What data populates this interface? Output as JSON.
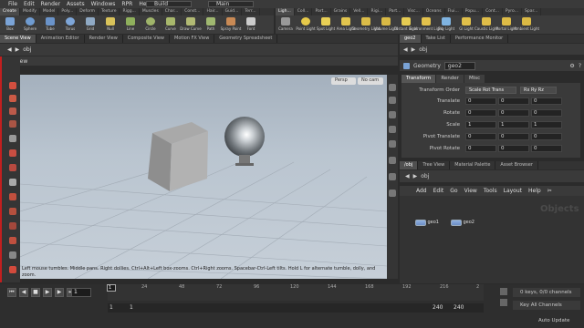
{
  "menubar": {
    "items": [
      "File",
      "Edit",
      "Render",
      "Assets",
      "Windows",
      "RPR",
      "Help"
    ],
    "desktop": "Build",
    "main": "Main"
  },
  "shelf_tabs_left": [
    "Create",
    "Modify",
    "Model",
    "Poly...",
    "Deform",
    "Texture",
    "Rigg...",
    "Muscles",
    "Char...",
    "Const...",
    "Hair...",
    "Guid...",
    "Terr...",
    "Simp..."
  ],
  "shelf_tabs_right": [
    "Ligh...",
    "Coll...",
    "Part...",
    "Grains",
    "Vell...",
    "Rigi...",
    "Part...",
    "Visc...",
    "Oceans",
    "Flui...",
    "Popu...",
    "Cont...",
    "Pyro...",
    "Spar...",
    "FEM"
  ],
  "shelf_tools_left": [
    "Box",
    "Sphere",
    "Tube",
    "Torus",
    "Grid",
    "Null",
    "Line",
    "Circle",
    "Curve",
    "Draw Curve",
    "Path",
    "Spray Paint",
    "Font"
  ],
  "shelf_tools_right": [
    "Camera",
    "Point Light",
    "Spot Light",
    "Area Light",
    "Geometry Light",
    "Volume Light",
    "Distant Light",
    "Environment Light",
    "Sky Light",
    "GI Light",
    "Caustic Light",
    "Portal Light",
    "Ambient Light"
  ],
  "pane_tabs_left": [
    "Scene View",
    "Animation Editor",
    "Render View",
    "Composite View",
    "Motion FX View",
    "Geometry Spreadsheet"
  ],
  "pane_tabs_right": [
    "geo2",
    "Take List",
    "Performance Monitor"
  ],
  "viewer": {
    "path": "obj",
    "title": "View",
    "persp": "Persp",
    "cam": "No cam",
    "hint": "Left mouse tumbles. Middle pans. Right dollies. Ctrl+Alt+Left box-zooms. Ctrl+Right zooms. Spacebar-Ctrl-Left tilts. Hold L for alternate tumble, dolly, and zoom."
  },
  "params": {
    "path": "obj",
    "node_type": "Geometry",
    "node_name": "geo2",
    "tabs": [
      "Transform",
      "Render",
      "Misc"
    ],
    "transform_order_label": "Transform Order",
    "transform_order": "Scale Rot Trans",
    "rot_order": "Rx Ry Rz",
    "rows": [
      {
        "label": "Translate",
        "values": [
          "0",
          "0",
          "0"
        ]
      },
      {
        "label": "Rotate",
        "values": [
          "0",
          "0",
          "0"
        ]
      },
      {
        "label": "Scale",
        "values": [
          "1",
          "1",
          "1"
        ]
      },
      {
        "label": "Pivot Translate",
        "values": [
          "0",
          "0",
          "0"
        ]
      },
      {
        "label": "Pivot Rotate",
        "values": [
          "0",
          "0",
          "0"
        ]
      }
    ]
  },
  "network": {
    "tabs": [
      "/obj",
      "Tree View",
      "Material Palette",
      "Asset Browser"
    ],
    "path": "obj",
    "menu": [
      "Add",
      "Edit",
      "Go",
      "View",
      "Tools",
      "Layout",
      "Help"
    ],
    "watermark": "Objects",
    "nodes": [
      "geo1",
      "geo2"
    ]
  },
  "timeline": {
    "frame": "1",
    "current": "1",
    "ticks": [
      "24",
      "48",
      "72",
      "96",
      "120",
      "144",
      "168",
      "192",
      "216",
      "2"
    ],
    "start": "1",
    "start2": "1",
    "end1": "240",
    "end2": "240",
    "keys_info": "0 keys, 0/0 channels",
    "channels": "Key All Channels",
    "auto_update": "Auto Update"
  }
}
